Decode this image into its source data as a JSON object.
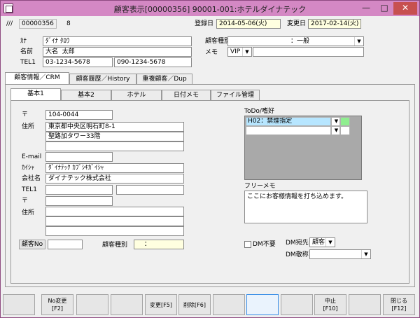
{
  "window": {
    "title": "顧客表示[00000356]  90001-001:ホテルダイナテック",
    "min": "—",
    "max": "□",
    "close": "✕"
  },
  "header": {
    "mark": "///",
    "record_id": "00000356",
    "count": "8",
    "reg_label": "登録日",
    "reg_date": "2014-05-06(火)",
    "upd_label": "変更日",
    "upd_date": "2017-02-14(火)"
  },
  "top": {
    "kana_label": "ｶﾅ",
    "kana_value": "ﾀﾞｲﾅ ﾀﾛｳ",
    "name_label": "名前",
    "last_name": "大名",
    "first_name": "太郎",
    "tel_label": "TEL1",
    "tel1": "03-1234-5678",
    "tel2": "090-1234-5678",
    "type_label": "顧客種別",
    "type_value": "：一般",
    "memo_label": "メモ",
    "memo_value": "VIP"
  },
  "tabs": [
    {
      "label": "顧客情報／CRM"
    },
    {
      "label": "顧客履歴／History"
    },
    {
      "label": "重複顧客／Dup"
    }
  ],
  "subtabs": [
    {
      "label": "基本1"
    },
    {
      "label": "基本2"
    },
    {
      "label": "ホテル"
    },
    {
      "label": "日付メモ"
    },
    {
      "label": "ファイル管理"
    }
  ],
  "form": {
    "zip_label": "〒",
    "zip_value": "104-0044",
    "addr_label": "住所",
    "addr1": "東京都中央区明石町8-1",
    "addr2": "聖路加タワー33階",
    "email_label": "E-mail",
    "company_kana_label": "ｶｲｼｬ",
    "company_kana": "ﾀﾞｲﾅﾃｯｸ ｶﾌﾞｼｷｶﾞｲｼｬ",
    "company_label": "会社名",
    "company": "ダイナテック株式会社",
    "tel_label": "TEL1",
    "zip2_label": "〒",
    "addr2_label": "住所",
    "custno_button": "顧客No",
    "kind_label": "顧客種別",
    "kind_value": "："
  },
  "todo": {
    "label": "ToDo/嗜好",
    "row1": "H02：禁煙指定",
    "row2": ""
  },
  "free_memo": {
    "label": "フリーメモ",
    "text": "ここにお客様情報を打ち込めます。"
  },
  "dm": {
    "nodm_label": "DM不要",
    "dest_label": "DM宛先",
    "dest_value": "顧客",
    "honor_label": "DM敬称"
  },
  "fkeys": [
    {
      "l1": "",
      "l2": ""
    },
    {
      "l1": "No変更",
      "l2": "[F2]"
    },
    {
      "l1": "",
      "l2": ""
    },
    {
      "l1": "",
      "l2": ""
    },
    {
      "l1": "変更[F5]",
      "l2": ""
    },
    {
      "l1": "削除[F6]",
      "l2": ""
    },
    {
      "l1": "",
      "l2": ""
    },
    {
      "l1": "",
      "l2": ""
    },
    {
      "l1": "",
      "l2": ""
    },
    {
      "l1": "中止",
      "l2": "[F10]"
    },
    {
      "l1": "",
      "l2": ""
    },
    {
      "l1": "閉じる",
      "l2": "[F12]"
    }
  ],
  "colors": {
    "title_bg": "#d488c4",
    "close_bg": "#c75050",
    "todo_highlight": "#b7e6ff",
    "todo_green": "#90ee90",
    "field_yellow": "#ffffe0"
  }
}
